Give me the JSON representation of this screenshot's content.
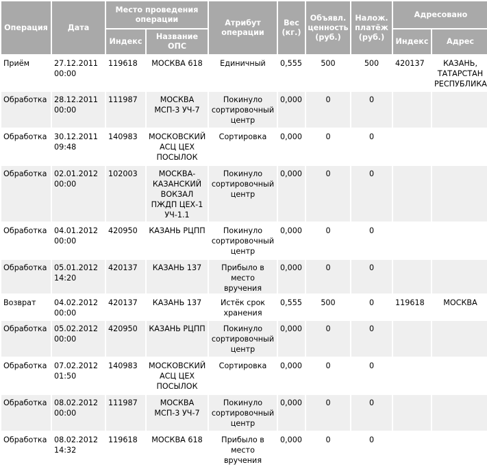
{
  "headers": {
    "operation": "Операция",
    "date": "Дата",
    "place": "Место проведения операции",
    "index": "Индекс",
    "ops_name": "Название ОПС",
    "attribute": "Атрибут операции",
    "weight": "Вес (кг.)",
    "declared_value": "Объявл. ценность (руб.)",
    "cod": "Налож. платёж (руб.)",
    "addressed": "Адресовано",
    "addr_index": "Индекс",
    "addr_address": "Адрес"
  },
  "rows": [
    {
      "operation": "Приём",
      "date": "27.12.2011 00:00",
      "index": "119618",
      "ops": "МОСКВА 618",
      "attr": "Единичный",
      "weight": "0,555",
      "value": "500",
      "cod": "500",
      "addr_index": "420137",
      "addr": "КАЗАНЬ, ТАТАРСТАН РЕСПУБЛИКА"
    },
    {
      "operation": "Обработка",
      "date": "28.12.2011 00:00",
      "index": "111987",
      "ops": "МОСКВА МСП-3 УЧ-7",
      "attr": "Покинуло сортировочный центр",
      "weight": "0,000",
      "value": "0",
      "cod": "0",
      "addr_index": "",
      "addr": ""
    },
    {
      "operation": "Обработка",
      "date": "30.12.2011 09:48",
      "index": "140983",
      "ops": "МОСКОВСКИЙ АСЦ ЦЕХ ПОСЫЛОК",
      "attr": "Сортировка",
      "weight": "0,000",
      "value": "0",
      "cod": "0",
      "addr_index": "",
      "addr": ""
    },
    {
      "operation": "Обработка",
      "date": "02.01.2012 00:00",
      "index": "102003",
      "ops": "МОСКВА-КАЗАНСКИЙ ВОКЗАЛ ПЖДП ЦЕХ-1 УЧ-1.1",
      "attr": "Покинуло сортировочный центр",
      "weight": "0,000",
      "value": "0",
      "cod": "0",
      "addr_index": "",
      "addr": ""
    },
    {
      "operation": "Обработка",
      "date": "04.01.2012 00:00",
      "index": "420950",
      "ops": "КАЗАНЬ РЦПП",
      "attr": "Покинуло сортировочный центр",
      "weight": "0,000",
      "value": "0",
      "cod": "0",
      "addr_index": "",
      "addr": ""
    },
    {
      "operation": "Обработка",
      "date": "05.01.2012 14:20",
      "index": "420137",
      "ops": "КАЗАНЬ 137",
      "attr": "Прибыло в место вручения",
      "weight": "0,000",
      "value": "0",
      "cod": "0",
      "addr_index": "",
      "addr": ""
    },
    {
      "operation": "Возврат",
      "date": "04.02.2012 00:00",
      "index": "420137",
      "ops": "КАЗАНЬ 137",
      "attr": "Истёк срок хранения",
      "weight": "0,555",
      "value": "500",
      "cod": "0",
      "addr_index": "119618",
      "addr": "МОСКВА"
    },
    {
      "operation": "Обработка",
      "date": "05.02.2012 00:00",
      "index": "420950",
      "ops": "КАЗАНЬ РЦПП",
      "attr": "Покинуло сортировочный центр",
      "weight": "0,000",
      "value": "0",
      "cod": "0",
      "addr_index": "",
      "addr": ""
    },
    {
      "operation": "Обработка",
      "date": "07.02.2012 01:50",
      "index": "140983",
      "ops": "МОСКОВСКИЙ АСЦ ЦЕХ ПОСЫЛОК",
      "attr": "Сортировка",
      "weight": "0,000",
      "value": "0",
      "cod": "0",
      "addr_index": "",
      "addr": ""
    },
    {
      "operation": "Обработка",
      "date": "08.02.2012 00:00",
      "index": "111987",
      "ops": "МОСКВА МСП-3 УЧ-7",
      "attr": "Покинуло сортировочный центр",
      "weight": "0,000",
      "value": "0",
      "cod": "0",
      "addr_index": "",
      "addr": ""
    },
    {
      "operation": "Обработка",
      "date": "08.02.2012 14:32",
      "index": "119618",
      "ops": "МОСКВА 618",
      "attr": "Прибыло в место вручения",
      "weight": "0,000",
      "value": "0",
      "cod": "0",
      "addr_index": "",
      "addr": ""
    }
  ]
}
